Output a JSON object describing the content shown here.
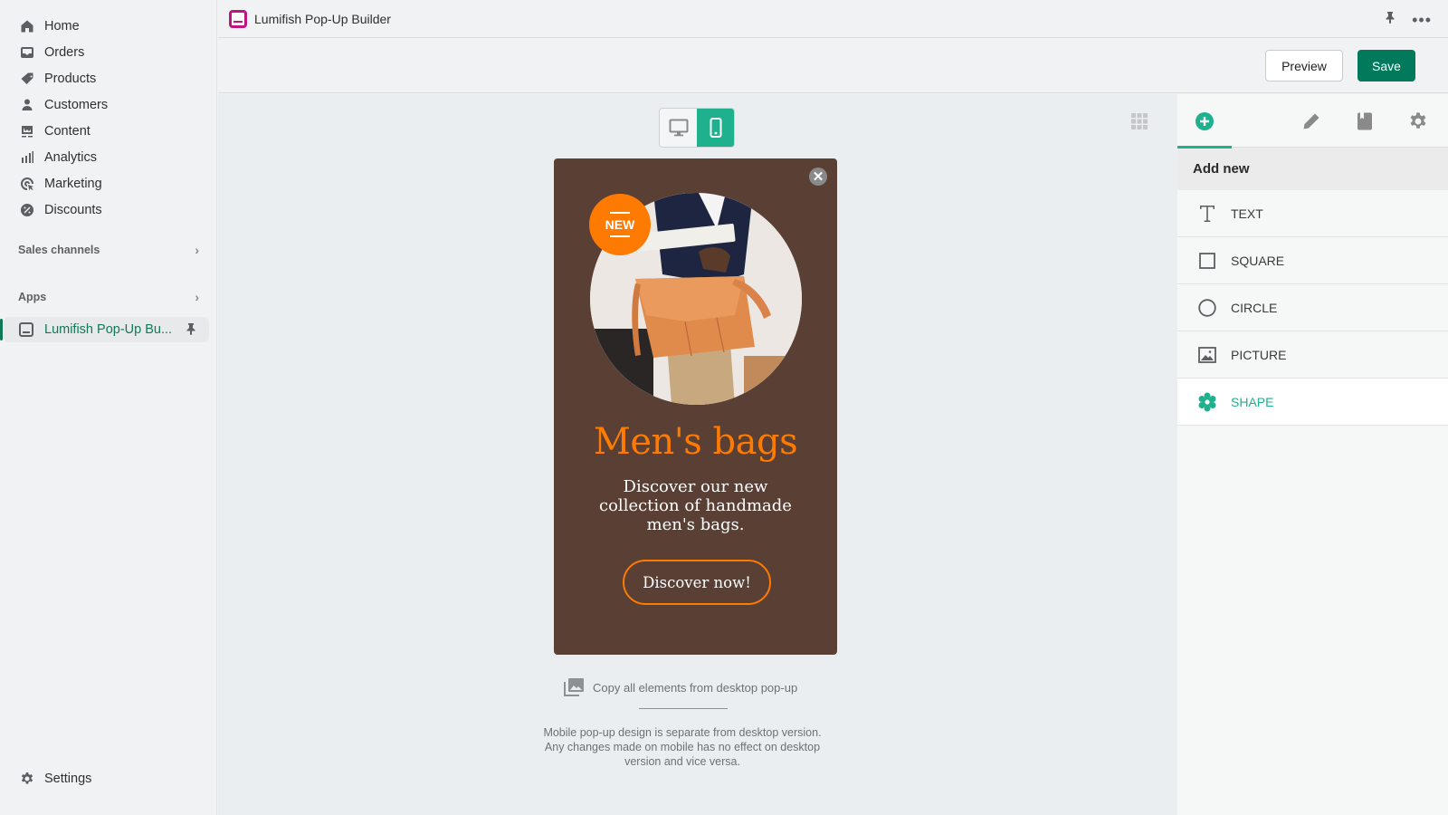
{
  "sidebar": {
    "items": [
      {
        "label": "Home",
        "icon": "home-icon"
      },
      {
        "label": "Orders",
        "icon": "inbox-icon"
      },
      {
        "label": "Products",
        "icon": "tag-icon"
      },
      {
        "label": "Customers",
        "icon": "person-icon"
      },
      {
        "label": "Content",
        "icon": "image-icon"
      },
      {
        "label": "Analytics",
        "icon": "bar-chart-icon"
      },
      {
        "label": "Marketing",
        "icon": "target-icon"
      },
      {
        "label": "Discounts",
        "icon": "discount-icon"
      }
    ],
    "sales_channels_label": "Sales channels",
    "apps_label": "Apps",
    "active_app_label": "Lumifish Pop-Up Bu...",
    "settings_label": "Settings"
  },
  "topbar": {
    "app_title": "Lumifish Pop-Up Builder",
    "more_label": "•••"
  },
  "actions": {
    "preview_label": "Preview",
    "save_label": "Save"
  },
  "colors": {
    "accent": "#1fb08e",
    "save": "#007a5a",
    "popup_bg": "#5a3f35",
    "popup_accent": "#ff7a00",
    "app_brand": "#c0157e"
  },
  "editor": {
    "device_options": [
      "desktop",
      "mobile"
    ],
    "selected_device": "mobile",
    "popup": {
      "close_label": "✕",
      "badge_label": "NEW",
      "title": "Men's bags",
      "body": "Discover our new collection of handmade men's bags.",
      "cta_label": "Discover now!"
    },
    "copy_label": "Copy all elements from desktop pop-up",
    "note": "Mobile pop-up design is separate from desktop version. Any changes made on mobile has no effect on desktop version and vice versa."
  },
  "panel": {
    "tabs": [
      "add",
      "edit",
      "pages",
      "settings"
    ],
    "active_tab": "add",
    "heading": "Add new",
    "elements": [
      {
        "label": "TEXT",
        "icon": "text-icon"
      },
      {
        "label": "SQUARE",
        "icon": "square-icon"
      },
      {
        "label": "CIRCLE",
        "icon": "circle-icon"
      },
      {
        "label": "PICTURE",
        "icon": "picture-icon"
      },
      {
        "label": "SHAPE",
        "icon": "flower-shape-icon",
        "active": true
      }
    ]
  }
}
